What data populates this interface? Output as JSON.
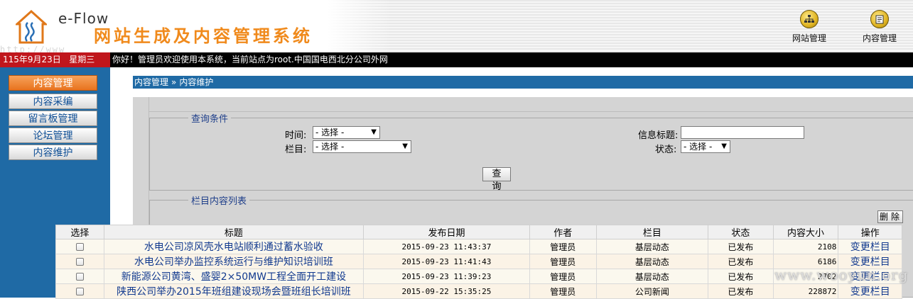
{
  "header": {
    "brand": "e-Flow",
    "system_title": "网站生成及内容管理系统",
    "url_fragment": "http://www",
    "nav": [
      {
        "label": "网站管理",
        "icon": "sitemap-icon"
      },
      {
        "label": "内容管理",
        "icon": "document-icon"
      }
    ]
  },
  "statusbar": {
    "date": "115年9月23日",
    "weekday": "星期三",
    "welcome": "你好！管理员欢迎使用本系统，当前站点为root.中国国电西北分公司外网"
  },
  "sidebar": {
    "items": [
      {
        "label": "内容管理",
        "active": true
      },
      {
        "label": "内容采编",
        "active": false
      },
      {
        "label": "留言板管理",
        "active": false
      },
      {
        "label": "论坛管理",
        "active": false
      },
      {
        "label": "内容维护",
        "active": false
      }
    ]
  },
  "breadcrumb": {
    "root": "内容管理",
    "sep": "»",
    "current": "内容维护"
  },
  "query": {
    "legend": "查询条件",
    "time_label": "时间:",
    "time_value": "- 选择 -",
    "column_label": "栏目:",
    "column_value": "- 选择 -",
    "title_label": "信息标题:",
    "title_value": "",
    "status_label": "状态:",
    "status_value": "- 选择 -",
    "search_button": "查询"
  },
  "list": {
    "legend": "栏目内容列表",
    "delete_button": "删除",
    "headers": [
      "选择",
      "标题",
      "发布日期",
      "作者",
      "栏目",
      "状态",
      "内容大小",
      "操作"
    ],
    "rows": [
      {
        "title": "水电公司凉风壳水电站顺利通过蓄水验收",
        "date": "2015-09-23 11:43:37",
        "author": "管理员",
        "column": "基层动态",
        "status": "已发布",
        "size": "2108",
        "op": "变更栏目"
      },
      {
        "title": "水电公司举办监控系统运行与维护知识培训班",
        "date": "2015-09-23 11:41:43",
        "author": "管理员",
        "column": "基层动态",
        "status": "已发布",
        "size": "6186",
        "op": "变更栏目"
      },
      {
        "title": "新能源公司黄湾、盛婴2×50MW工程全面开工建设",
        "date": "2015-09-23 11:39:23",
        "author": "管理员",
        "column": "基层动态",
        "status": "已发布",
        "size": "2702",
        "op": "变更栏目"
      },
      {
        "title": "陕西公司举办2015年班组建设现场会暨班组长培训班",
        "date": "2015-09-22 15:35:25",
        "author": "管理员",
        "column": "公司新闻",
        "status": "已发布",
        "size": "228872",
        "op": "变更栏目"
      }
    ]
  },
  "watermark": "www.wooyun.org",
  "colors": {
    "sidebar": "#1f6aa5",
    "accent": "#e8731f",
    "statusbar": "#000000",
    "date_box": "#c0161c"
  }
}
